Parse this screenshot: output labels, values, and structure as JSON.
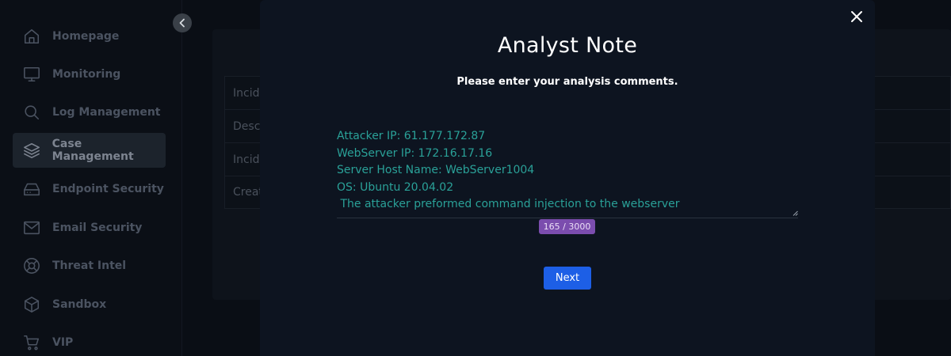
{
  "sidebar": {
    "items": [
      {
        "label": "Homepage",
        "icon": "home-icon"
      },
      {
        "label": "Monitoring",
        "icon": "monitor-icon"
      },
      {
        "label": "Log Management",
        "icon": "search-icon"
      },
      {
        "label": "Case Management",
        "icon": "layers-icon",
        "active": true
      },
      {
        "label": "Endpoint Security",
        "icon": "hard-drive-icon"
      },
      {
        "label": "Email Security",
        "icon": "mail-icon"
      },
      {
        "label": "Threat Intel",
        "icon": "lifebuoy-icon"
      },
      {
        "label": "Sandbox",
        "icon": "box-icon"
      },
      {
        "label": "VIP",
        "icon": "cart-icon"
      }
    ]
  },
  "background": {
    "rows": [
      "Incide",
      "Descr",
      "Incide",
      "Creat"
    ]
  },
  "modal": {
    "title": "Analyst Note",
    "subtitle": "Please enter your analysis comments.",
    "note_lines": [
      "Attacker IP: 61.177.172.87",
      "WebServer IP: 172.16.17.16",
      "Server Host Name: WebServer1004",
      "OS: Ubuntu 20.04.02",
      " The attacker preformed command injection to the webserver"
    ],
    "char_count": "165 / 3000",
    "next_label": "Next"
  },
  "colors": {
    "note_text": "#2aa198",
    "counter_badge": "#7b4dae",
    "primary_button": "#1d5fe6",
    "modal_bg": "#0d1420"
  }
}
